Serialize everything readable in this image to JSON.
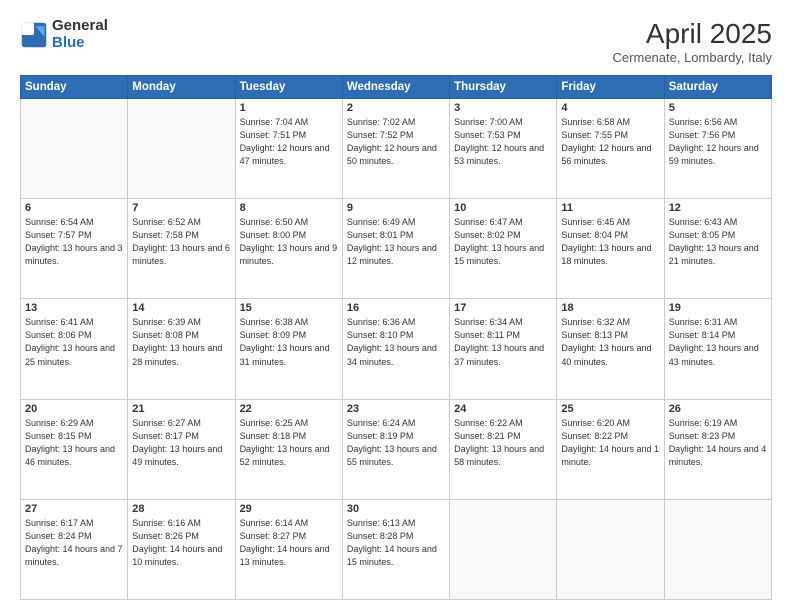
{
  "header": {
    "logo_general": "General",
    "logo_blue": "Blue",
    "title": "April 2025",
    "location": "Cermenate, Lombardy, Italy"
  },
  "weekdays": [
    "Sunday",
    "Monday",
    "Tuesday",
    "Wednesday",
    "Thursday",
    "Friday",
    "Saturday"
  ],
  "weeks": [
    [
      {
        "day": "",
        "info": ""
      },
      {
        "day": "",
        "info": ""
      },
      {
        "day": "1",
        "info": "Sunrise: 7:04 AM\nSunset: 7:51 PM\nDaylight: 12 hours and 47 minutes."
      },
      {
        "day": "2",
        "info": "Sunrise: 7:02 AM\nSunset: 7:52 PM\nDaylight: 12 hours and 50 minutes."
      },
      {
        "day": "3",
        "info": "Sunrise: 7:00 AM\nSunset: 7:53 PM\nDaylight: 12 hours and 53 minutes."
      },
      {
        "day": "4",
        "info": "Sunrise: 6:58 AM\nSunset: 7:55 PM\nDaylight: 12 hours and 56 minutes."
      },
      {
        "day": "5",
        "info": "Sunrise: 6:56 AM\nSunset: 7:56 PM\nDaylight: 12 hours and 59 minutes."
      }
    ],
    [
      {
        "day": "6",
        "info": "Sunrise: 6:54 AM\nSunset: 7:57 PM\nDaylight: 13 hours and 3 minutes."
      },
      {
        "day": "7",
        "info": "Sunrise: 6:52 AM\nSunset: 7:58 PM\nDaylight: 13 hours and 6 minutes."
      },
      {
        "day": "8",
        "info": "Sunrise: 6:50 AM\nSunset: 8:00 PM\nDaylight: 13 hours and 9 minutes."
      },
      {
        "day": "9",
        "info": "Sunrise: 6:49 AM\nSunset: 8:01 PM\nDaylight: 13 hours and 12 minutes."
      },
      {
        "day": "10",
        "info": "Sunrise: 6:47 AM\nSunset: 8:02 PM\nDaylight: 13 hours and 15 minutes."
      },
      {
        "day": "11",
        "info": "Sunrise: 6:45 AM\nSunset: 8:04 PM\nDaylight: 13 hours and 18 minutes."
      },
      {
        "day": "12",
        "info": "Sunrise: 6:43 AM\nSunset: 8:05 PM\nDaylight: 13 hours and 21 minutes."
      }
    ],
    [
      {
        "day": "13",
        "info": "Sunrise: 6:41 AM\nSunset: 8:06 PM\nDaylight: 13 hours and 25 minutes."
      },
      {
        "day": "14",
        "info": "Sunrise: 6:39 AM\nSunset: 8:08 PM\nDaylight: 13 hours and 28 minutes."
      },
      {
        "day": "15",
        "info": "Sunrise: 6:38 AM\nSunset: 8:09 PM\nDaylight: 13 hours and 31 minutes."
      },
      {
        "day": "16",
        "info": "Sunrise: 6:36 AM\nSunset: 8:10 PM\nDaylight: 13 hours and 34 minutes."
      },
      {
        "day": "17",
        "info": "Sunrise: 6:34 AM\nSunset: 8:11 PM\nDaylight: 13 hours and 37 minutes."
      },
      {
        "day": "18",
        "info": "Sunrise: 6:32 AM\nSunset: 8:13 PM\nDaylight: 13 hours and 40 minutes."
      },
      {
        "day": "19",
        "info": "Sunrise: 6:31 AM\nSunset: 8:14 PM\nDaylight: 13 hours and 43 minutes."
      }
    ],
    [
      {
        "day": "20",
        "info": "Sunrise: 6:29 AM\nSunset: 8:15 PM\nDaylight: 13 hours and 46 minutes."
      },
      {
        "day": "21",
        "info": "Sunrise: 6:27 AM\nSunset: 8:17 PM\nDaylight: 13 hours and 49 minutes."
      },
      {
        "day": "22",
        "info": "Sunrise: 6:25 AM\nSunset: 8:18 PM\nDaylight: 13 hours and 52 minutes."
      },
      {
        "day": "23",
        "info": "Sunrise: 6:24 AM\nSunset: 8:19 PM\nDaylight: 13 hours and 55 minutes."
      },
      {
        "day": "24",
        "info": "Sunrise: 6:22 AM\nSunset: 8:21 PM\nDaylight: 13 hours and 58 minutes."
      },
      {
        "day": "25",
        "info": "Sunrise: 6:20 AM\nSunset: 8:22 PM\nDaylight: 14 hours and 1 minute."
      },
      {
        "day": "26",
        "info": "Sunrise: 6:19 AM\nSunset: 8:23 PM\nDaylight: 14 hours and 4 minutes."
      }
    ],
    [
      {
        "day": "27",
        "info": "Sunrise: 6:17 AM\nSunset: 8:24 PM\nDaylight: 14 hours and 7 minutes."
      },
      {
        "day": "28",
        "info": "Sunrise: 6:16 AM\nSunset: 8:26 PM\nDaylight: 14 hours and 10 minutes."
      },
      {
        "day": "29",
        "info": "Sunrise: 6:14 AM\nSunset: 8:27 PM\nDaylight: 14 hours and 13 minutes."
      },
      {
        "day": "30",
        "info": "Sunrise: 6:13 AM\nSunset: 8:28 PM\nDaylight: 14 hours and 15 minutes."
      },
      {
        "day": "",
        "info": ""
      },
      {
        "day": "",
        "info": ""
      },
      {
        "day": "",
        "info": ""
      }
    ]
  ]
}
